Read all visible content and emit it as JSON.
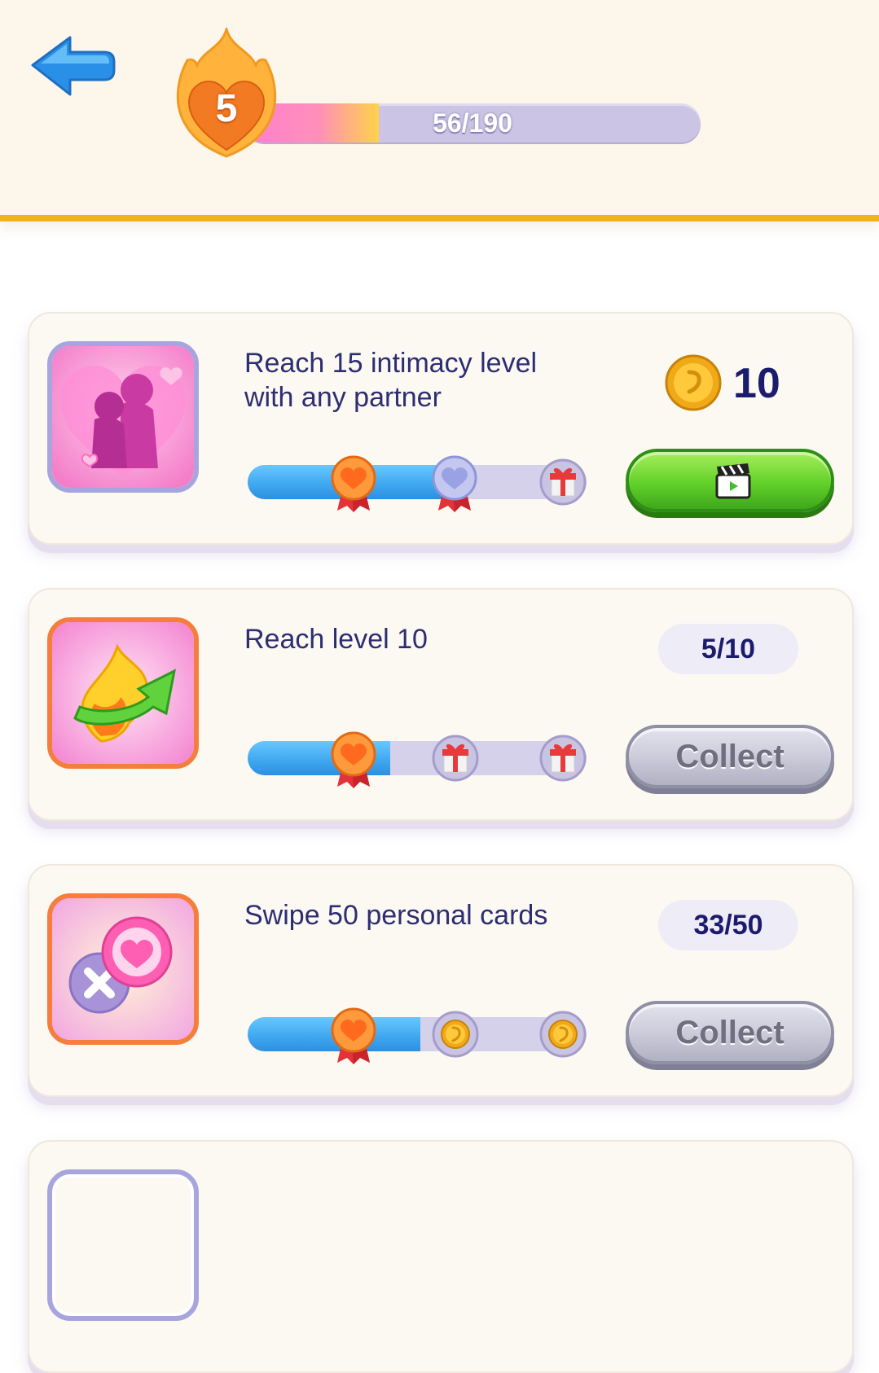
{
  "header": {
    "level": "5",
    "xp_text": "56/190",
    "xp_current": 56,
    "xp_max": 190
  },
  "tasks": [
    {
      "title": "Reach 15 intimacy level with any partner",
      "reward_amount": "10",
      "reward_icon": "gold-coin-icon",
      "progress_fraction": 0.6,
      "action": "video-ad",
      "action_icon": "video-clapper-icon"
    },
    {
      "title": "Reach level 10",
      "count": "5/10",
      "progress_fraction": 0.42,
      "button_label": "Collect"
    },
    {
      "title": "Swipe 50 personal cards",
      "count": "33/50",
      "progress_fraction": 0.51,
      "button_label": "Collect"
    }
  ],
  "colors": {
    "header_bg": "#fdf6ea",
    "header_border": "#f2b21b",
    "title_text": "#2c2e72",
    "progress_blue": "#3ea6ef",
    "track": "#d6d1ea",
    "green_button": "#62d12b",
    "grey_button": "#c9c9d8"
  }
}
